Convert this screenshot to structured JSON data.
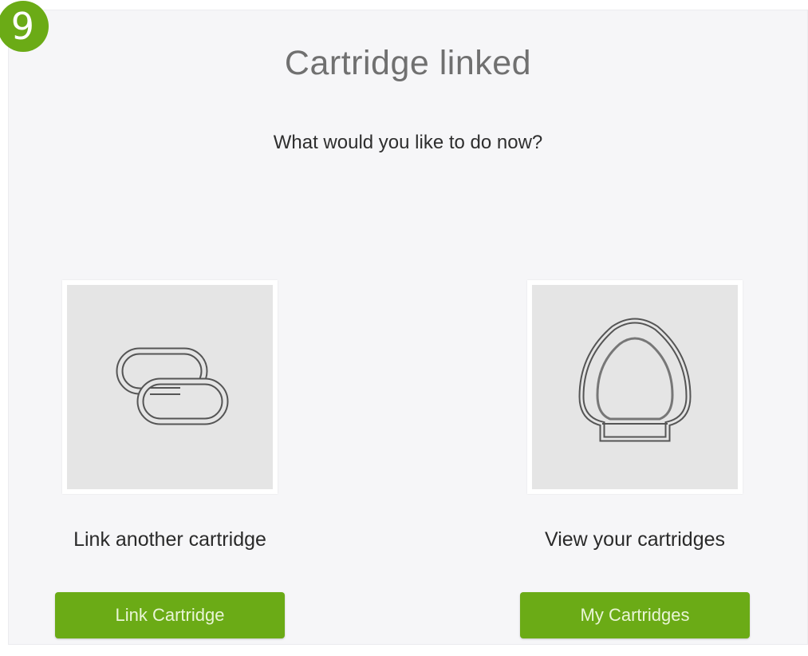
{
  "step": {
    "number": "9",
    "color": "#6bab16"
  },
  "dialog": {
    "title": "Cartridge linked",
    "subtitle": "What would you like to do now?"
  },
  "options": [
    {
      "icon": "link-icon",
      "label": "Link another cartridge",
      "button_label": "Link Cartridge"
    },
    {
      "icon": "cartridge-icon",
      "label": "View your cartridges",
      "button_label": "My Cartridges"
    }
  ],
  "colors": {
    "accent": "#6bab16",
    "panel_background": "#f6f6f8",
    "tile_background": "#e5e5e5"
  }
}
